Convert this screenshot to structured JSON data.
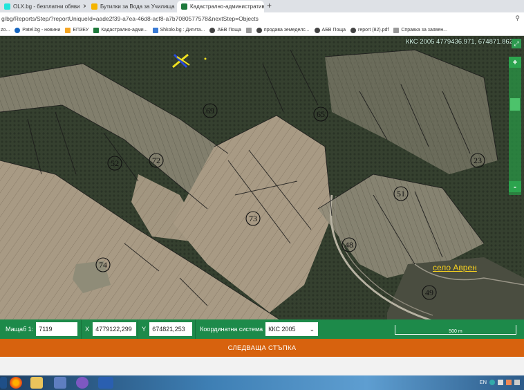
{
  "browser": {
    "tabs": [
      {
        "title": "OLX.bg - безплатни обяви",
        "favicon_color": "#23e5db"
      },
      {
        "title": "Бутилки за Вода за Училища | К",
        "favicon_color": "#f5b400"
      },
      {
        "title": "Кадастрално-административна",
        "favicon_color": "#1f7a3c"
      }
    ],
    "active_tab_index": 2,
    "new_tab_symbol": "+",
    "close_symbol": "✕",
    "address": "g/bg/Reports/Step/?reportUniqueId=aade2f39-a7ea-46d8-acf8-a7b7080577578&nextStep=Objects",
    "zoom_icon": "magnifier-icon",
    "bookmarks": [
      {
        "label": "zo...",
        "color": "#888888"
      },
      {
        "label": "Patel.bg - новини",
        "color": "#1565c0"
      },
      {
        "label": "ЕПЗЕУ",
        "color": "#f5a623"
      },
      {
        "label": "Кадастрално-адми...",
        "color": "#1f7a3c"
      },
      {
        "label": "Shkolo.bg : Дигита...",
        "color": "#3a7bd5"
      },
      {
        "label": "АБВ Поща",
        "color": "#444444"
      },
      {
        "label": "продава земеделс...",
        "color": "#444444"
      },
      {
        "label": "АБВ Поща",
        "color": "#444444"
      },
      {
        "label": "report (82).pdf",
        "color": "#444444"
      },
      {
        "label": "Справка за заявен...",
        "color": "#888888"
      }
    ]
  },
  "map": {
    "coordinate_readout": "ККС 2005 4779436.971, 674871.862",
    "expand_symbol": "⤢",
    "zoom_in_label": "+",
    "zoom_out_label": "-",
    "parcel_labels": [
      "69",
      "65",
      "72",
      "52",
      "73",
      "51",
      "48",
      "74",
      "23",
      "49"
    ],
    "place_label": "село Аврен",
    "marker_color": "#f0e020"
  },
  "toolbar": {
    "scale_label": "Мащаб  1:",
    "scale_value": "7119",
    "x_label": "X",
    "x_value": "4779122,299",
    "y_label": "Y",
    "y_value": "674821,253",
    "crs_label": "Координатна система",
    "crs_value": "ККС 2005",
    "scalebar_label": "500 m"
  },
  "next_step_label": "СЛЕДВАЩА СТЪПКА",
  "taskbar": {
    "icons": [
      "start-orb-icon",
      "firefox-icon",
      "file-explorer-icon",
      "network-icon",
      "viber-icon",
      "word-icon"
    ],
    "tray_language": "EN"
  },
  "colors": {
    "toolbar_green": "#1d8a4a",
    "next_button_orange": "#d7620e",
    "place_label_yellow": "#f5d020"
  }
}
